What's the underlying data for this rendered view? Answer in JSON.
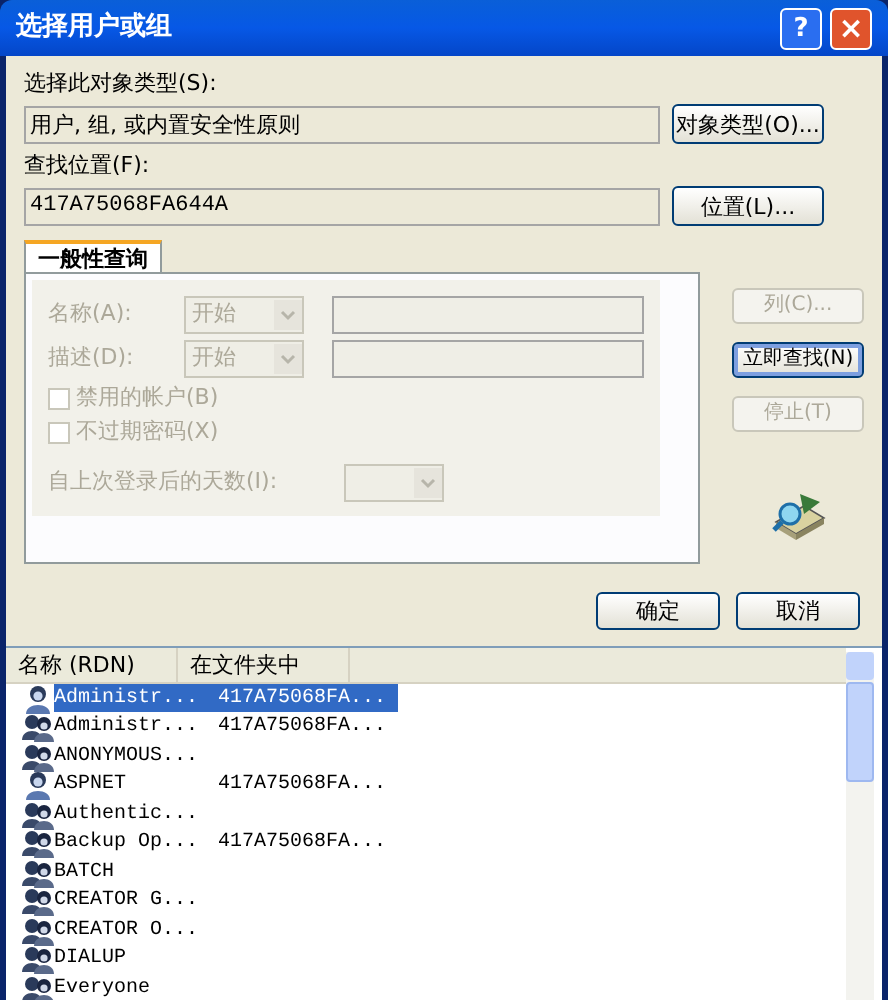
{
  "window": {
    "title": "选择用户或组",
    "help": "?",
    "close": "×"
  },
  "object_type": {
    "label": "选择此对象类型(S):",
    "value": "用户, 组, 或内置安全性原则",
    "button": "对象类型(O)..."
  },
  "location": {
    "label": "查找位置(F):",
    "value": "417A75068FA644A",
    "button": "位置(L)..."
  },
  "tabs": [
    {
      "label": "一般性查询",
      "selected": true
    }
  ],
  "query": {
    "disabled": true,
    "fields": [
      {
        "label": "名称(A):",
        "mode": "开始"
      },
      {
        "label": "描述(D):",
        "mode": "开始"
      }
    ],
    "checkboxes": [
      {
        "label": "禁用的帐户(B)",
        "checked": false
      },
      {
        "label": "不过期密码(X)",
        "checked": false
      }
    ],
    "days_label": "自上次登录后的天数(I):"
  },
  "side_buttons": [
    {
      "label": "列(C)...",
      "disabled": true,
      "default": false
    },
    {
      "label": "立即查找(N)",
      "disabled": false,
      "default": true
    },
    {
      "label": "停止(T)",
      "disabled": true,
      "default": false
    }
  ],
  "buttons": [
    "确定",
    "取消"
  ],
  "results": {
    "columns": [
      "名称 (RDN)",
      "在文件夹中"
    ],
    "rows": [
      {
        "kind": "user",
        "name": "Administr...",
        "folder": "417A75068FA...",
        "selected": true
      },
      {
        "kind": "group",
        "name": "Administr...",
        "folder": "417A75068FA...",
        "selected": false
      },
      {
        "kind": "group",
        "name": "ANONYMOUS...",
        "selected": false
      },
      {
        "kind": "user",
        "name": "ASPNET",
        "folder": "417A75068FA...",
        "selected": false
      },
      {
        "kind": "group",
        "name": "Authentic...",
        "selected": false
      },
      {
        "kind": "group",
        "name": "Backup Op...",
        "folder": "417A75068FA...",
        "selected": false
      },
      {
        "kind": "group",
        "name": "BATCH",
        "selected": false
      },
      {
        "kind": "group",
        "name": "CREATOR G...",
        "selected": false
      },
      {
        "kind": "group",
        "name": "CREATOR O...",
        "selected": false
      },
      {
        "kind": "group",
        "name": "DIALUP",
        "selected": false
      },
      {
        "kind": "group",
        "name": "Everyone",
        "selected": false
      }
    ]
  }
}
